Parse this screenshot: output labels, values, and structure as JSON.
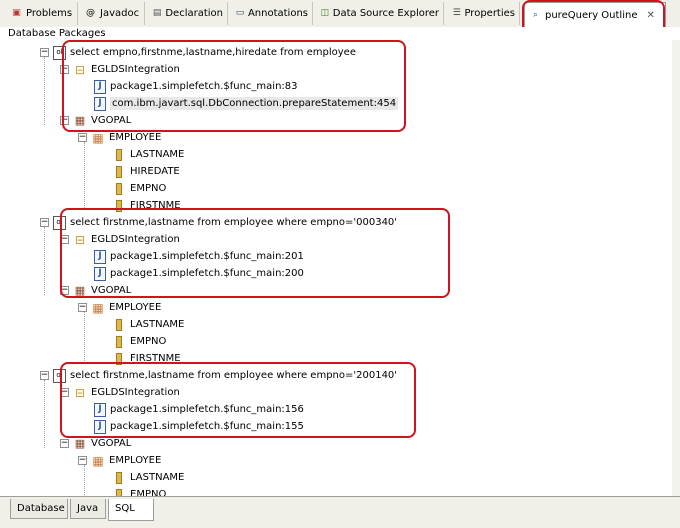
{
  "tabs": [
    {
      "label": "Problems",
      "icon": "problems-icon"
    },
    {
      "label": "Javadoc",
      "icon": "at-icon"
    },
    {
      "label": "Declaration",
      "icon": "declaration-icon"
    },
    {
      "label": "Annotations",
      "icon": "annotations-icon"
    },
    {
      "label": "Data Source Explorer",
      "icon": "data-source-icon"
    },
    {
      "label": "Properties",
      "icon": "properties-icon"
    },
    {
      "label": "pureQuery Outline",
      "icon": "purequery-icon",
      "active": true
    }
  ],
  "view_title": "Database Packages",
  "tree": {
    "statements": [
      {
        "sql": "select empno,firstnme,lastname,hiredate from employee",
        "integration": "EGLDSIntegration",
        "methods": [
          "package1.simplefetch.$func_main:83",
          "com.ibm.javart.sql.DbConnection.prepareStatement:454"
        ],
        "schema": "VGOPAL",
        "table": "EMPLOYEE",
        "columns": [
          "LASTNAME",
          "HIREDATE",
          "EMPNO",
          "FIRSTNME"
        ]
      },
      {
        "sql": "select firstnme,lastname from employee where empno='000340'",
        "integration": "EGLDSIntegration",
        "methods": [
          "package1.simplefetch.$func_main:201",
          "package1.simplefetch.$func_main:200"
        ],
        "schema": "VGOPAL",
        "table": "EMPLOYEE",
        "columns": [
          "LASTNAME",
          "EMPNO",
          "FIRSTNME"
        ]
      },
      {
        "sql": "select firstnme,lastname from employee where empno='200140'",
        "integration": "EGLDSIntegration",
        "methods": [
          "package1.simplefetch.$func_main:156",
          "package1.simplefetch.$func_main:155"
        ],
        "schema": "VGOPAL",
        "table": "EMPLOYEE",
        "columns": [
          "LASTNAME",
          "EMPNO"
        ]
      }
    ]
  },
  "bottom_tabs": [
    {
      "label": "Database"
    },
    {
      "label": "Java"
    },
    {
      "label": "SQL",
      "active": true
    }
  ],
  "colors": {
    "highlight_box": "#d0131e",
    "tab_bar": "#f1f0e8"
  }
}
